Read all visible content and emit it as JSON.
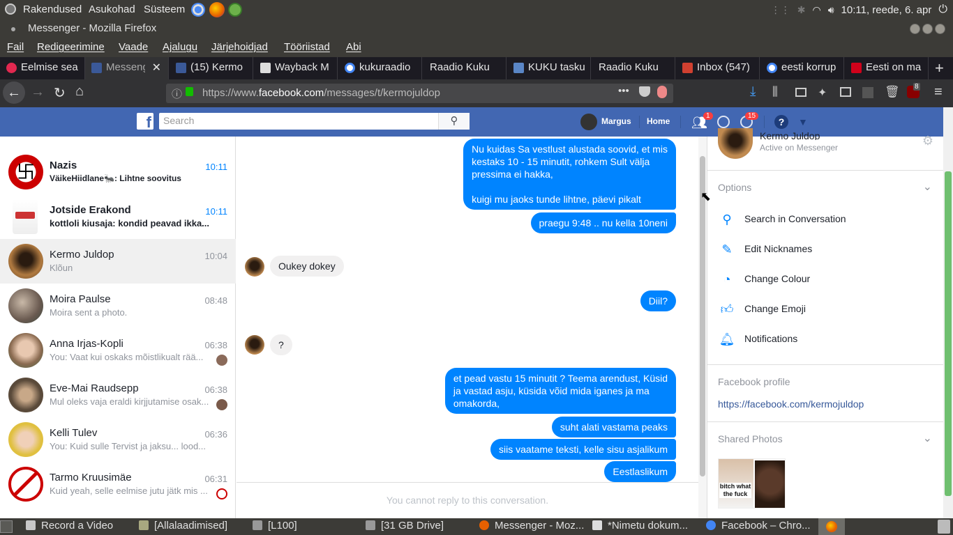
{
  "top_panel": {
    "menus": [
      "Rakendused",
      "Asukohad",
      "Süsteem"
    ],
    "clock": "10:11, reede, 6. apr"
  },
  "window": {
    "title": "Messenger - Mozilla Firefox"
  },
  "menubar": [
    "Fail",
    "Redigeerimine",
    "Vaade",
    "Ajalugu",
    "Järjehoidjad",
    "Tööriistad",
    "Abi"
  ],
  "tabs": [
    "Eelmise sea",
    "Messeng",
    "(15) Kermo",
    "Wayback M",
    "kukuraadio",
    "Raadio Kuku",
    "KUKU tasku",
    "Raadio Kuku",
    "Inbox (547)",
    "eesti korrup",
    "Eesti on ma"
  ],
  "url": {
    "prefix": "https://www.",
    "domain": "facebook.com",
    "path": "/messages/t/kermojuldop"
  },
  "addon_badge": "8",
  "fb": {
    "search_placeholder": "Search",
    "user": "Margus",
    "home": "Home",
    "friend_badge": "1",
    "notif_badge": "15"
  },
  "conversations": [
    {
      "name": "Nazis",
      "msg": "VäikeHiidlane🐜: Lihtne soovitus",
      "time": "10:11",
      "bold": true
    },
    {
      "name": "Jotside Erakond",
      "msg": "kottloli kiusaja: kondid peavad ikka...",
      "time": "10:11",
      "bold": true
    },
    {
      "name": "Kermo Juldop",
      "msg": "Klõun",
      "time": "10:04",
      "bold": false
    },
    {
      "name": "Moira Paulse",
      "msg": "Moira sent a photo.",
      "time": "08:48",
      "bold": false
    },
    {
      "name": "Anna Irjas-Kopli",
      "msg": "You: Vaat kui oskaks mõistlikualt rää...",
      "time": "06:38",
      "bold": false
    },
    {
      "name": "Eve-Mai Raudsepp",
      "msg": "Mul oleks vaja eraldi kirjjutamise osak...",
      "time": "06:38",
      "bold": false
    },
    {
      "name": "Kelli Tulev",
      "msg": "You: Kuid sulle Tervist ja jaksu... lood...",
      "time": "06:36",
      "bold": false
    },
    {
      "name": "Tarmo Kruusimäe",
      "msg": "Kuid yeah, selle eelmise jutu jätk mis ...",
      "time": "06:31",
      "bold": false
    }
  ],
  "messages": {
    "m1": "Nu kuidas Sa vestlust alustada soovid, et mis\nkestaks 10 - 15 minutit, rohkem Sult välja\npressima ei hakka,\n\nkuigi mu jaoks tunde lihtne, päevi pikalt",
    "m2": "praegu 9:48 .. nu kella 10neni",
    "m3": "Oukey dokey",
    "m4": "Diil?",
    "m5": "?",
    "m6": "et pead vastu 15 minutit ? Teema arendust, Küsid\nja vastad asju, küsida võid mida iganes ja ma\nomakorda,",
    "m7": "suht alati vastama peaks",
    "m8": "siis vaatame teksti, kelle sisu asjalikum",
    "m9": "Eestlaslikum",
    "cannot_reply": "You cannot reply to this conversation."
  },
  "right": {
    "name": "Kermo Juldop",
    "status": "Active on Messenger",
    "options_title": "Options",
    "options": [
      "Search in Conversation",
      "Edit Nicknames",
      "Change Colour",
      "Change Emoji",
      "Notifications"
    ],
    "profile_title": "Facebook profile",
    "profile_link": "https://facebook.com/kermojuldop",
    "photos_title": "Shared Photos",
    "photo_caption": "bitch what the fuck"
  },
  "taskbar": [
    "Record a Video",
    "[Allalaadimised]",
    "[L100]",
    "[31 GB Drive]",
    "Messenger - Moz...",
    "*Nimetu dokum...",
    "Facebook – Chro..."
  ]
}
